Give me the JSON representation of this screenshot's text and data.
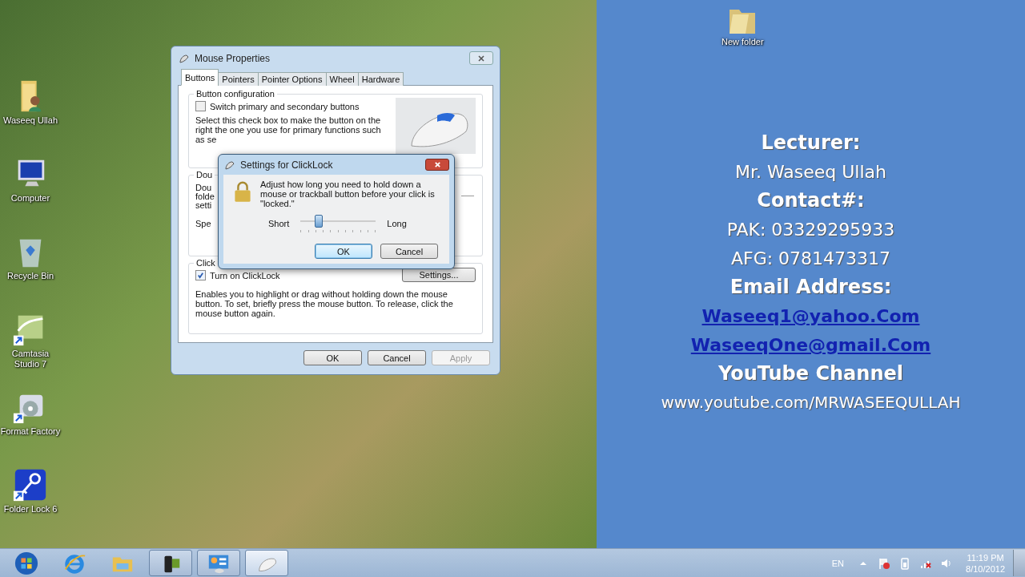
{
  "desktop_icons": [
    {
      "label": "Waseeq Ullah",
      "kind": "user-folder",
      "shortcut": false
    },
    {
      "label": "Computer",
      "kind": "computer",
      "shortcut": false
    },
    {
      "label": "Recycle Bin",
      "kind": "recycle-bin",
      "shortcut": false
    },
    {
      "label": "Camtasia Studio 7",
      "kind": "camtasia",
      "shortcut": true
    },
    {
      "label": "Format Factory",
      "kind": "format-factory",
      "shortcut": true
    },
    {
      "label": "Folder Lock 6",
      "kind": "folder-lock",
      "shortcut": true
    }
  ],
  "info_panel": {
    "folder_icon": {
      "label": "New folder"
    },
    "lines": [
      {
        "text": "Lecturer:",
        "kind": "heading"
      },
      {
        "text": "Mr. Waseeq Ullah",
        "kind": "plain"
      },
      {
        "text": "Contact#:",
        "kind": "heading"
      },
      {
        "text": "PAK: 03329295933",
        "kind": "plain"
      },
      {
        "text": "AFG: 0781473317",
        "kind": "plain"
      },
      {
        "text": "Email Address:",
        "kind": "heading"
      },
      {
        "text": "Waseeq1@yahoo.Com",
        "kind": "link"
      },
      {
        "text": "WaseeqOne@gmail.Com",
        "kind": "link"
      },
      {
        "text": "YouTube Channel",
        "kind": "heading"
      },
      {
        "text": "www.youtube.com/MRWASEEQULLAH",
        "kind": "plain"
      }
    ]
  },
  "mouse_properties": {
    "title": "Mouse Properties",
    "tabs": [
      {
        "label": "Buttons",
        "selected": true
      },
      {
        "label": "Pointers",
        "selected": false
      },
      {
        "label": "Pointer Options",
        "selected": false
      },
      {
        "label": "Wheel",
        "selected": false
      },
      {
        "label": "Hardware",
        "selected": false
      }
    ],
    "button_configuration": {
      "legend": "Button configuration",
      "checkbox": {
        "label": "Switch primary and secondary buttons",
        "checked": false
      },
      "description": "Select this check box to make the button on the right the one you use for primary functions such",
      "description_cut": "as se"
    },
    "double_click": {
      "legend": "Dou",
      "lines": [
        "Dou",
        "folde",
        "setti"
      ],
      "speed": "Spe"
    },
    "clicklock": {
      "legend": "Click",
      "checkbox": {
        "label": "Turn on ClickLock",
        "checked": true
      },
      "settings_button": "Settings...",
      "description": "Enables you to highlight or drag without holding down the mouse button. To set, briefly press the mouse button. To release, click the mouse button again."
    },
    "buttons": [
      {
        "label": "OK",
        "disabled": false
      },
      {
        "label": "Cancel",
        "disabled": false
      },
      {
        "label": "Apply",
        "disabled": true
      }
    ]
  },
  "clicklock_dialog": {
    "title": "Settings for ClickLock",
    "message": "Adjust how long you need to hold down a mouse or trackball button before your click is \"locked.\"",
    "slider": {
      "min_label": "Short",
      "max_label": "Long",
      "level": 0.24
    },
    "buttons": [
      {
        "label": "OK",
        "default": true
      },
      {
        "label": "Cancel",
        "default": false
      }
    ]
  },
  "taskbar": {
    "items": [
      {
        "kind": "start",
        "open": false,
        "active": false
      },
      {
        "kind": "browser",
        "open": false,
        "active": false
      },
      {
        "kind": "explorer",
        "open": false,
        "active": false
      },
      {
        "kind": "camera",
        "open": true,
        "active": false
      },
      {
        "kind": "control-panel",
        "open": true,
        "active": false
      },
      {
        "kind": "mouse",
        "open": true,
        "active": true
      }
    ],
    "tray": {
      "language": "EN",
      "time": "11:19 PM",
      "date": "8/10/2012"
    }
  }
}
